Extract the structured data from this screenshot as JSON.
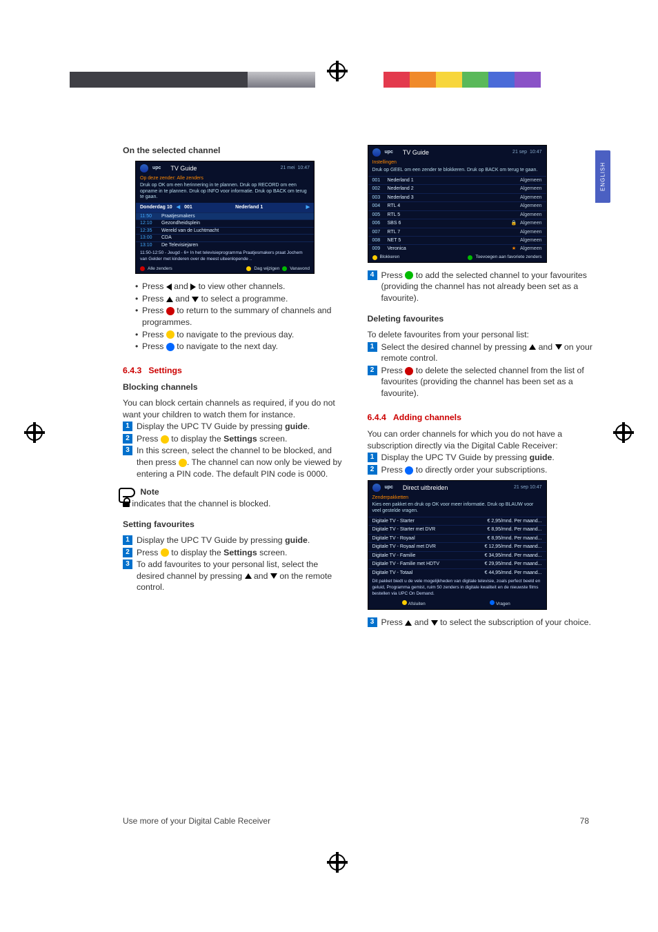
{
  "side_tab": "ENGLISH",
  "top_swatches": [
    "#e33a4d",
    "#f08a2b",
    "#f7d63c",
    "#5ab95a",
    "#4a6bd8",
    "#8a52c7"
  ],
  "footer": {
    "left": "Use more of your Digital Cable Receiver",
    "page": "78"
  },
  "left_col": {
    "heading_selected": "On the selected channel",
    "ss1": {
      "brand": "upc",
      "title": "TV Guide",
      "date": "21 mei",
      "time": "10:47",
      "sub": "Op deze zender: Alle zenders",
      "hint": "Druk op OK om een herinnering in te plannen. Druk op RECORD om een opname in te plannen. Druk op INFO voor informatie. Druk op BACK om terug te gaan.",
      "bar_left": "Donderdag 10",
      "bar_mid_num": "001",
      "bar_mid": "Nederland 1",
      "rows": [
        {
          "t": "11:50",
          "p": "Praatjesmakers"
        },
        {
          "t": "12:10",
          "p": "Gezondheidsplein"
        },
        {
          "t": "12:35",
          "p": "Wereld van de Luchtmacht"
        },
        {
          "t": "13:00",
          "p": "CDA"
        },
        {
          "t": "13:10",
          "p": "De Televisiejaren"
        }
      ],
      "foot": "11:50-12:50 - Jeugd - 6+ In het televisieprogramma Praatjesmakers praat Jochem van Gelder met kinderen over de meest uiteenlopende ..",
      "legend": [
        "Alle zenders",
        "Dag wijzigen",
        "Vanavond"
      ]
    },
    "bullets": [
      {
        "pre": "Press ",
        "icons": [
          "arrow-l",
          "arrow-r"
        ],
        "post": " to view other channels.",
        "sep": " and "
      },
      {
        "pre": "Press ",
        "icons": [
          "arrow-u",
          "arrow-d"
        ],
        "post": " to select a programme.",
        "sep": " and "
      },
      {
        "pre": "Press ",
        "dot": "red",
        "post": " to return to the summary of channels and programmes."
      },
      {
        "pre": "Press ",
        "dot": "yel",
        "post": " to navigate to the previous day."
      },
      {
        "pre": "Press ",
        "dot": "blu",
        "post": " to navigate to the next day."
      }
    ],
    "sec_643": {
      "num": "6.4.3",
      "title": "Settings"
    },
    "blocking": {
      "title": "Blocking channels",
      "intro": "You can block certain channels as required, if you do not want your children to watch them for instance.",
      "steps": [
        {
          "n": "1",
          "html": "Display the UPC TV Guide by pressing <b>guide</b>."
        },
        {
          "n": "2",
          "html": "Press <span class='dot yel'></span> to display the <b>Settings</b> screen."
        },
        {
          "n": "3",
          "html": "In this screen, select the channel to be blocked, and then press <span class='dot yel'></span>. The channel can now only be viewed by entering a PIN code. The default PIN code is 0000."
        }
      ],
      "note_title": "Note",
      "note_text": " indicates that the channel is blocked."
    },
    "setting_fav": {
      "title": "Setting favourites",
      "steps": [
        {
          "n": "1",
          "html": "Display the UPC TV Guide by pressing <b>guide</b>."
        },
        {
          "n": "2",
          "html": "Press <span class='dot yel'></span> to display the <b>Settings</b> screen."
        },
        {
          "n": "3",
          "html": "To add favourites to your personal list, select the desired channel by pressing <span class='arrow-u'></span> and <span class='arrow-d'></span> on the remote control."
        }
      ]
    }
  },
  "right_col": {
    "ss2": {
      "brand": "upc",
      "title": "TV Guide",
      "date": "21 sep",
      "time": "10:47",
      "sub": "Instellingen",
      "hint": "Druk op GEEL om een zender te blokkeren. Druk op BACK om terug te gaan.",
      "rows": [
        [
          "001",
          "Nederland 1",
          "",
          "Algemeen"
        ],
        [
          "002",
          "Nederland 2",
          "",
          "Algemeen"
        ],
        [
          "003",
          "Nederland 3",
          "",
          "Algemeen"
        ],
        [
          "004",
          "RTL 4",
          "",
          "Algemeen"
        ],
        [
          "005",
          "RTL 5",
          "",
          "Algemeen"
        ],
        [
          "006",
          "SBS 6",
          "🔒",
          "Algemeen"
        ],
        [
          "007",
          "RTL 7",
          "",
          "Algemeen"
        ],
        [
          "008",
          "NET 5",
          "",
          "Algemeen"
        ],
        [
          "009",
          "Veronica",
          "★",
          "Algemeen"
        ]
      ],
      "legend": [
        "Blokkeren",
        "Toevoegen aan favoriete zenders"
      ]
    },
    "step4": {
      "n": "4",
      "html": "Press <span class='dot grn'></span> to add the selected channel to your favourites (providing the channel has not already been set as a favourite)."
    },
    "deleting": {
      "title": "Deleting favourites",
      "intro": "To delete favourites from your personal list:",
      "steps": [
        {
          "n": "1",
          "html": "Select the desired channel by pressing <span class='arrow-u'></span> and <span class='arrow-d'></span> on your remote control."
        },
        {
          "n": "2",
          "html": "Press <span class='dot red'></span> to delete the selected channel from the list of favourites (providing the channel has been set as a favourite)."
        }
      ]
    },
    "sec_644": {
      "num": "6.4.4",
      "title": "Adding channels"
    },
    "adding": {
      "intro": "You can order channels for which you do not have a subscription directly via the Digital Cable Receiver:",
      "steps": [
        {
          "n": "1",
          "html": "Display the UPC TV Guide by pressing <b>guide</b>."
        },
        {
          "n": "2",
          "html": "Press <span class='dot blu'></span> to directly order your subscriptions."
        }
      ]
    },
    "ss3": {
      "brand": "upc",
      "title": "Direct uitbreiden",
      "date": "21 sep 10:47",
      "sub": "Zenderpakketten",
      "hint": "Kies een pakket en druk op OK voor meer informatie. Druk op BLAUW voor veel gestelde vragen.",
      "rows": [
        [
          "Digitale TV - Starter",
          "€ 2,95/mnd. Per maand..."
        ],
        [
          "Digitale TV - Starter met DVR",
          "€ 8,95/mnd. Per maand..."
        ],
        [
          "Digitale TV - Royaal",
          "€ 8,95/mnd. Per maand..."
        ],
        [
          "Digitale TV - Royaal met DVR",
          "€ 12,95/mnd. Per maand..."
        ],
        [
          "Digitale TV - Familie",
          "€ 34,95/mnd. Per maand..."
        ],
        [
          "Digitale TV - Familie met HDTV",
          "€ 29,95/mnd. Per maand..."
        ],
        [
          "Digitale TV - Totaal",
          "€ 44,95/mnd. Per maand..."
        ]
      ],
      "foot": "Dit pakket biedt u de vele mogelijkheden van digitale televisie, zoals perfect beeld en geluid, Programma gemist, ruim 50 zenders in digitale kwaliteit en de nieuwste films bestellen via UPC On Demand.",
      "legend1": "Afsluiten",
      "legend2": "Vragen"
    },
    "step3_bottom": {
      "n": "3",
      "html": "Press <span class='arrow-u'></span> and <span class='arrow-d'></span> to select the subscription of your choice."
    }
  }
}
